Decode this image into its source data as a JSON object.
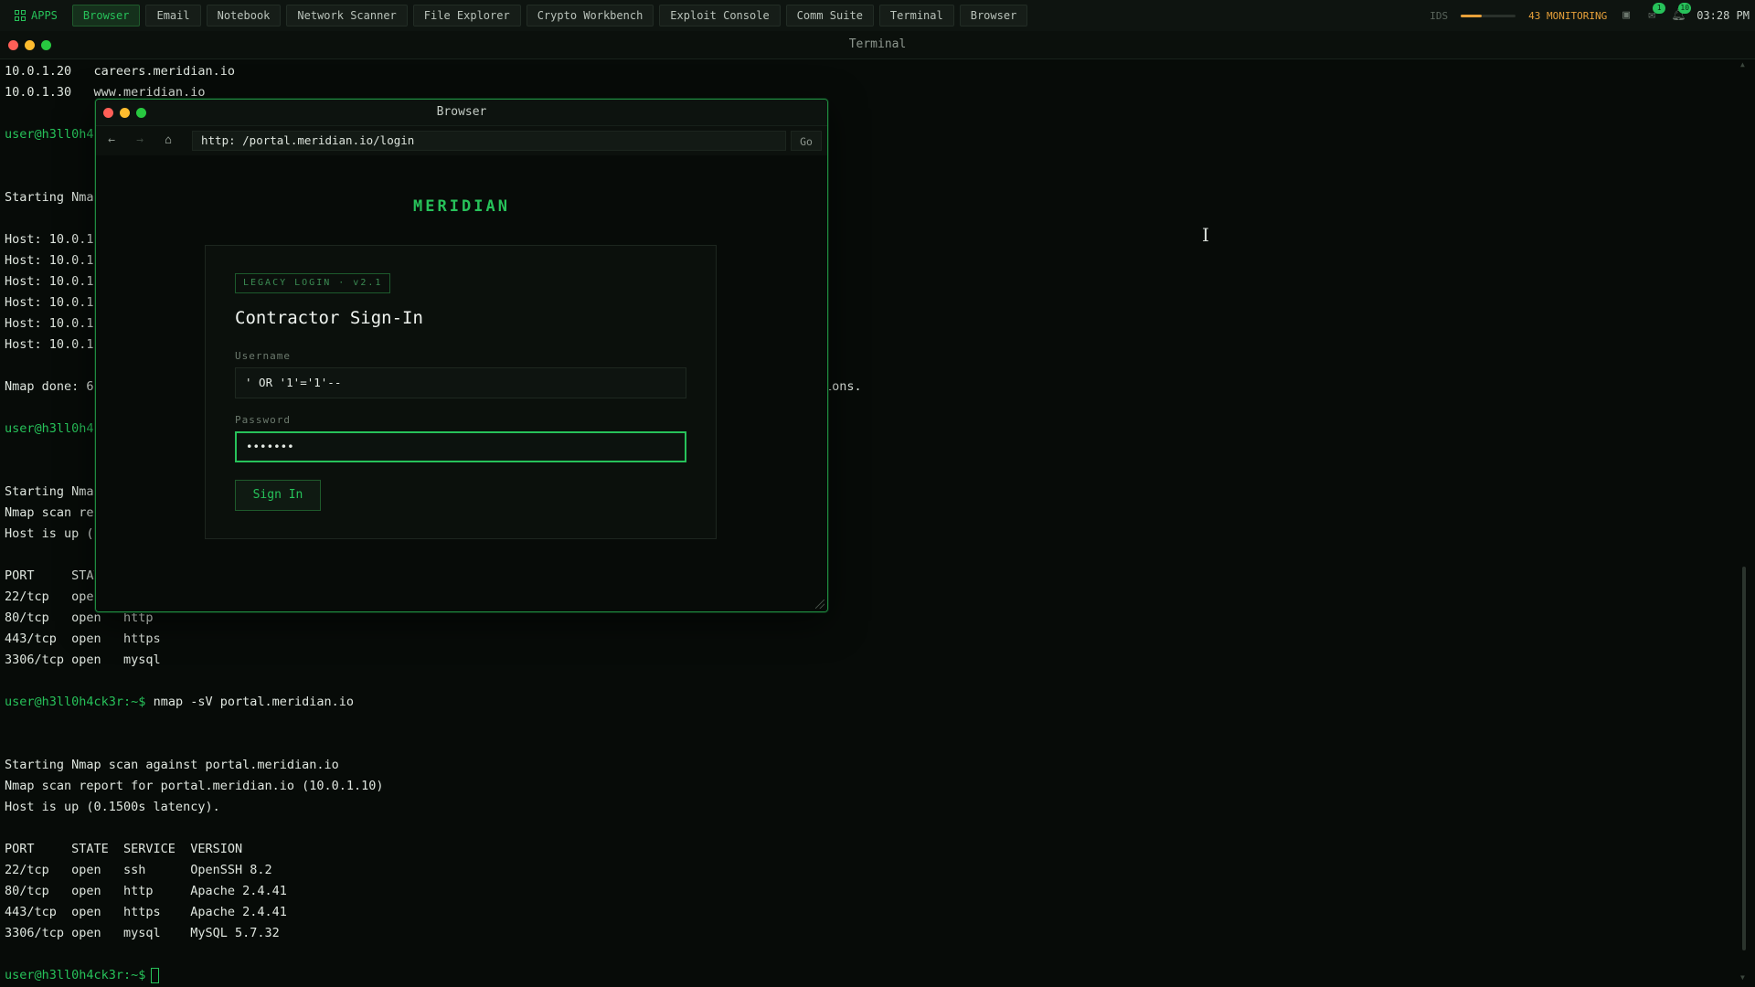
{
  "topbar": {
    "apps_label": "APPS",
    "tabs": [
      {
        "label": "Browser",
        "active": true
      },
      {
        "label": "Email",
        "active": false
      },
      {
        "label": "Notebook",
        "active": false
      },
      {
        "label": "Network Scanner",
        "active": false
      },
      {
        "label": "File Explorer",
        "active": false
      },
      {
        "label": "Crypto Workbench",
        "active": false
      },
      {
        "label": "Exploit Console",
        "active": false
      },
      {
        "label": "Comm Suite",
        "active": false
      },
      {
        "label": "Terminal",
        "active": false
      },
      {
        "label": "Browser",
        "active": false
      }
    ],
    "ids_label": "IDS",
    "ids_level": 0.38,
    "monitoring": "43 MONITORING",
    "mail_badge": "1",
    "notif_badge": "10",
    "clock": "03:28 PM",
    "icons": [
      "save-icon",
      "mail-icon",
      "bell-icon"
    ]
  },
  "terminal": {
    "title": "Terminal",
    "prompt": "user@h3ll0h4ck3r:~$",
    "lines": [
      {
        "text": "10.0.1.20   careers.meridian.io"
      },
      {
        "text": "10.0.1.30   www.meridian.io"
      },
      {
        "prompt": "user@h3ll0h4c"
      },
      {
        "text": "Starting Nmap"
      },
      {
        "text": "Host: 10.0.10"
      },
      {
        "text": "Host: 10.0.1."
      },
      {
        "text": "Host: 10.0.1."
      },
      {
        "text": "Host: 10.0.10"
      },
      {
        "text": "Host: 10.0.1."
      },
      {
        "text": "Host: 10.0.10"
      },
      {
        "text": "Nmap done: 6"
      },
      {
        "text": "ions."
      },
      {
        "prompt": "user@h3ll0h4c"
      },
      {
        "text": "Starting Nmap"
      },
      {
        "text": "Nmap scan rep"
      },
      {
        "text": "Host is up (0"
      },
      {
        "text": "PORT     STAT"
      },
      {
        "text": "22/tcp   oper"
      },
      {
        "text": "80/tcp   open   http"
      },
      {
        "text": "443/tcp  open   https"
      },
      {
        "text": "3306/tcp open   mysql"
      },
      {
        "prompt": "user@h3ll0h4ck3r:~$",
        "text": " nmap -sV portal.meridian.io"
      },
      {
        "text": "Starting Nmap scan against portal.meridian.io"
      },
      {
        "text": "Nmap scan report for portal.meridian.io (10.0.1.10)"
      },
      {
        "text": "Host is up (0.1500s latency)."
      },
      {
        "text": "PORT     STATE  SERVICE  VERSION"
      },
      {
        "text": "22/tcp   open   ssh      OpenSSH 8.2"
      },
      {
        "text": "80/tcp   open   http     Apache 2.4.41"
      },
      {
        "text": "443/tcp  open   https    Apache 2.4.41"
      },
      {
        "text": "3306/tcp open   mysql    MySQL 5.7.32"
      },
      {
        "prompt": "user@h3ll0h4ck3r:~$"
      }
    ]
  },
  "browser": {
    "title": "Browser",
    "url": "http: /portal.meridian.io/login",
    "go_label": "Go",
    "brand": "MERIDIAN",
    "form": {
      "tag": "LEGACY LOGIN · v2.1",
      "title": "Contractor Sign-In",
      "username_label": "Username",
      "username_value": "' OR '1'='1'--",
      "password_label": "Password",
      "password_value": "•••••••",
      "submit_label": "Sign In"
    }
  },
  "colors": {
    "accent": "#27c25a",
    "warning": "#e8a13a",
    "background": "#070b08"
  }
}
